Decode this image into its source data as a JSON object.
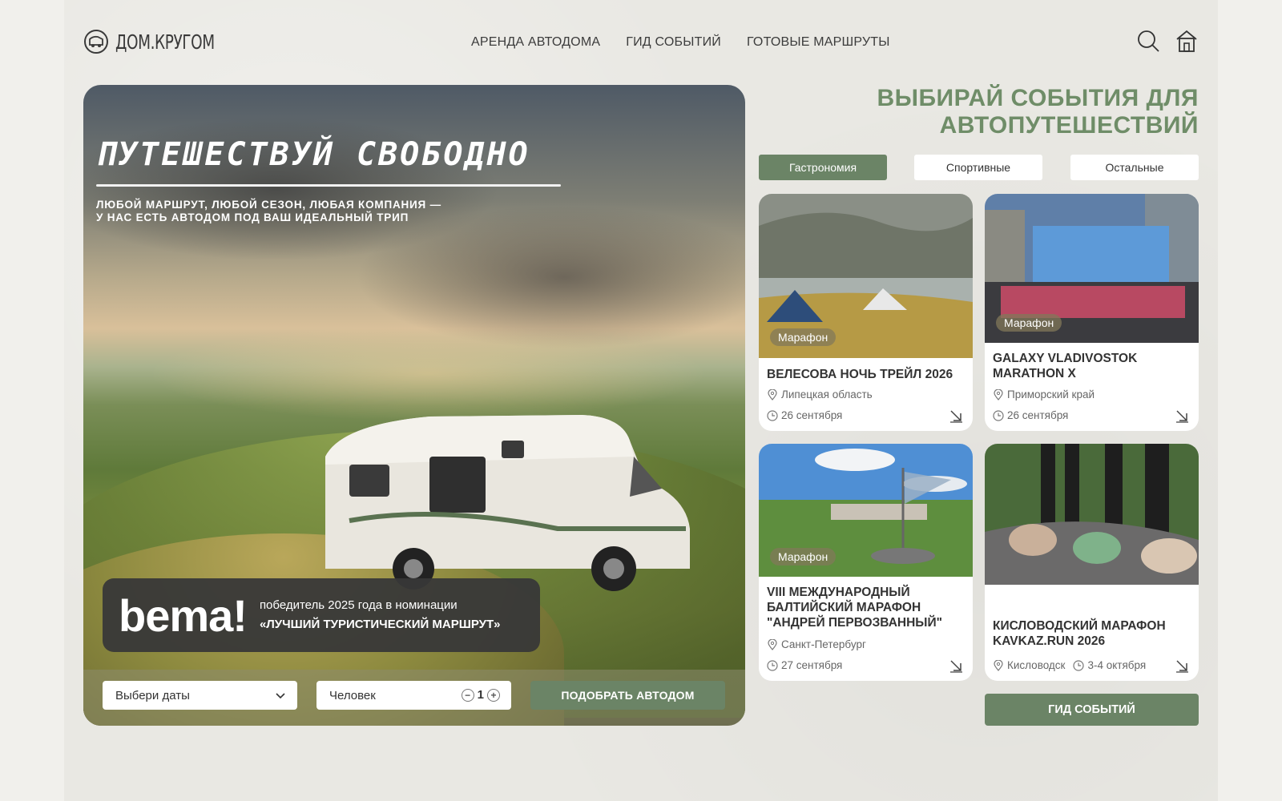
{
  "logo": {
    "text": "ДОМ.КРУГОМ"
  },
  "nav": [
    {
      "label": "АРЕНДА АВТОДОМА"
    },
    {
      "label": "ГИД СОБЫТИЙ"
    },
    {
      "label": "ГОТОВЫЕ МАРШРУТЫ"
    }
  ],
  "hero": {
    "title": "ПУТЕШЕСТВУЙ СВОБОДНО",
    "subtitle_line1": "ЛЮБОЙ МАРШРУТ, ЛЮБОЙ СЕЗОН, ЛЮБАЯ КОМПАНИЯ —",
    "subtitle_line2": "У НАС ЕСТЬ АВТОДОМ ПОД ВАШ ИДЕАЛЬНЫЙ ТРИП",
    "award_logo": "bema!",
    "award_line1": "победитель 2025 года в номинации",
    "award_line2": "«ЛУЧШИЙ ТУРИСТИЧЕСКИЙ МАРШРУТ»",
    "dates_placeholder": "Выбери даты",
    "people_label": "Человек",
    "people_count": "1",
    "pick_button": "ПОДОБРАТЬ АВТОДОМ"
  },
  "events": {
    "heading_line1": "ВЫБИРАЙ СОБЫТИЯ ДЛЯ",
    "heading_line2": "АВТОПУТЕШЕСТВИЙ",
    "tabs": [
      {
        "label": "Гастрономия",
        "active": true
      },
      {
        "label": "Спортивные",
        "active": false
      },
      {
        "label": "Остальные",
        "active": false
      }
    ],
    "cards": [
      {
        "badge": "Марафон",
        "title": "ВЕЛЕСОВА НОЧЬ ТРЕЙЛ 2026",
        "location": "Липецкая область",
        "date": "26 сентября"
      },
      {
        "badge": "Марафон",
        "title": "GALAXY VLADIVOSTOK MARATHON X",
        "location": "Приморский край",
        "date": "26 сентября"
      },
      {
        "badge": "Марафон",
        "title": "VIII МЕЖДУНАРОДНЫЙ БАЛТИЙСКИЙ МАРАФОН \"АНДРЕЙ ПЕРВОЗВАННЫЙ\"",
        "location": "Санкт-Петербург",
        "date": "27 сентября"
      },
      {
        "badge": "",
        "title": "КИСЛОВОДСКИЙ МАРАФОН KAVKAZ.RUN 2026",
        "location": "Кисловодск",
        "date": "3-4 октября"
      }
    ],
    "guide_button": "ГИД СОБЫТИЙ"
  }
}
